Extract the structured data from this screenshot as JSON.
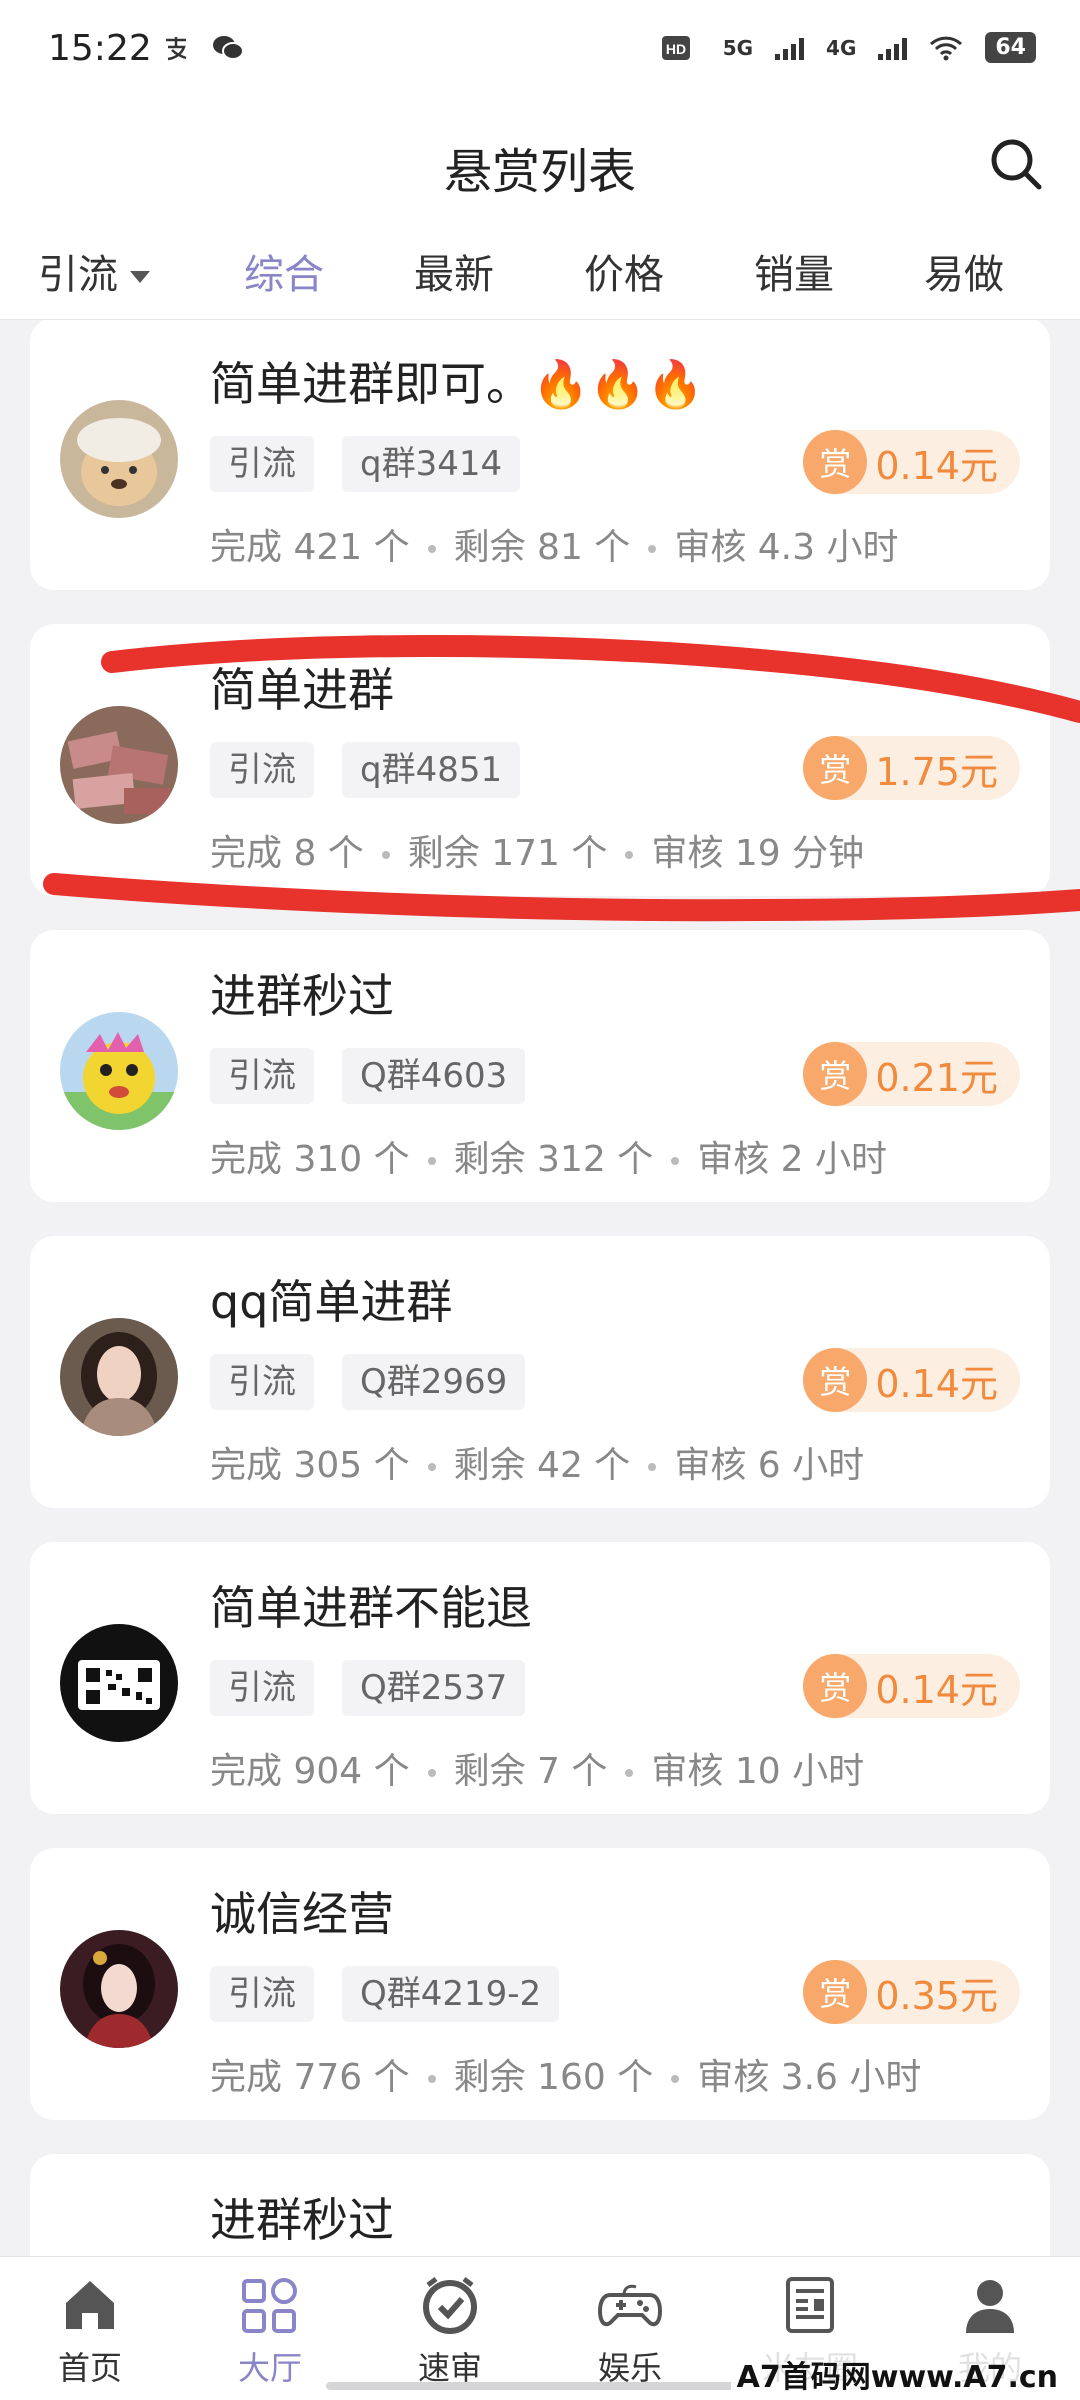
{
  "status_bar": {
    "time": "15:22",
    "network_5g": "5G",
    "network_4g": "4G",
    "battery": "64"
  },
  "header": {
    "title": "悬赏列表",
    "search_icon": "search-icon"
  },
  "tabs": [
    {
      "label": "引流",
      "dropdown": true
    },
    {
      "label": "综合",
      "active": true
    },
    {
      "label": "最新"
    },
    {
      "label": "价格"
    },
    {
      "label": "销量"
    },
    {
      "label": "易做"
    }
  ],
  "tasks": [
    {
      "title": "简单进群即可。🔥🔥🔥",
      "category": "引流",
      "tag": "q群3414",
      "reward_badge": "赏",
      "reward": "0.14元",
      "completed": "完成 421 个",
      "remaining": "剩余 81 个",
      "review": "审核 4.3 小时"
    },
    {
      "title": "简单进群",
      "category": "引流",
      "tag": "q群4851",
      "reward_badge": "赏",
      "reward": "1.75元",
      "completed": "完成 8 个",
      "remaining": "剩余 171 个",
      "review": "审核 19 分钟"
    },
    {
      "title": "进群秒过",
      "category": "引流",
      "tag": "Q群4603",
      "reward_badge": "赏",
      "reward": "0.21元",
      "completed": "完成 310 个",
      "remaining": "剩余 312 个",
      "review": "审核 2 小时"
    },
    {
      "title": "qq简单进群",
      "category": "引流",
      "tag": "Q群2969",
      "reward_badge": "赏",
      "reward": "0.14元",
      "completed": "完成 305 个",
      "remaining": "剩余 42 个",
      "review": "审核 6 小时"
    },
    {
      "title": "简单进群不能退",
      "category": "引流",
      "tag": "Q群2537",
      "reward_badge": "赏",
      "reward": "0.14元",
      "completed": "完成 904 个",
      "remaining": "剩余 7 个",
      "review": "审核 10 小时"
    },
    {
      "title": "诚信经营",
      "category": "引流",
      "tag": "Q群4219-2",
      "reward_badge": "赏",
      "reward": "0.35元",
      "completed": "完成 776 个",
      "remaining": "剩余 160 个",
      "review": "审核 3.6 小时"
    },
    {
      "title": "进群秒过"
    }
  ],
  "bottom_nav": [
    {
      "label": "首页",
      "icon": "home-icon"
    },
    {
      "label": "大厅",
      "icon": "grid-icon",
      "active": true
    },
    {
      "label": "速审",
      "icon": "alarm-clock-icon"
    },
    {
      "label": "娱乐",
      "icon": "gamepad-icon"
    },
    {
      "label": "米友圈",
      "icon": "newspaper-icon"
    },
    {
      "label": "我的",
      "icon": "user-icon"
    }
  ],
  "watermark": "A7首码网www.A7.cn",
  "colors": {
    "accent": "#8a84c8",
    "reward_text": "#f08a3c",
    "reward_badge": "#f7a86a",
    "reward_bg": "#fdeee2",
    "annotation_stroke": "#e8322c"
  }
}
